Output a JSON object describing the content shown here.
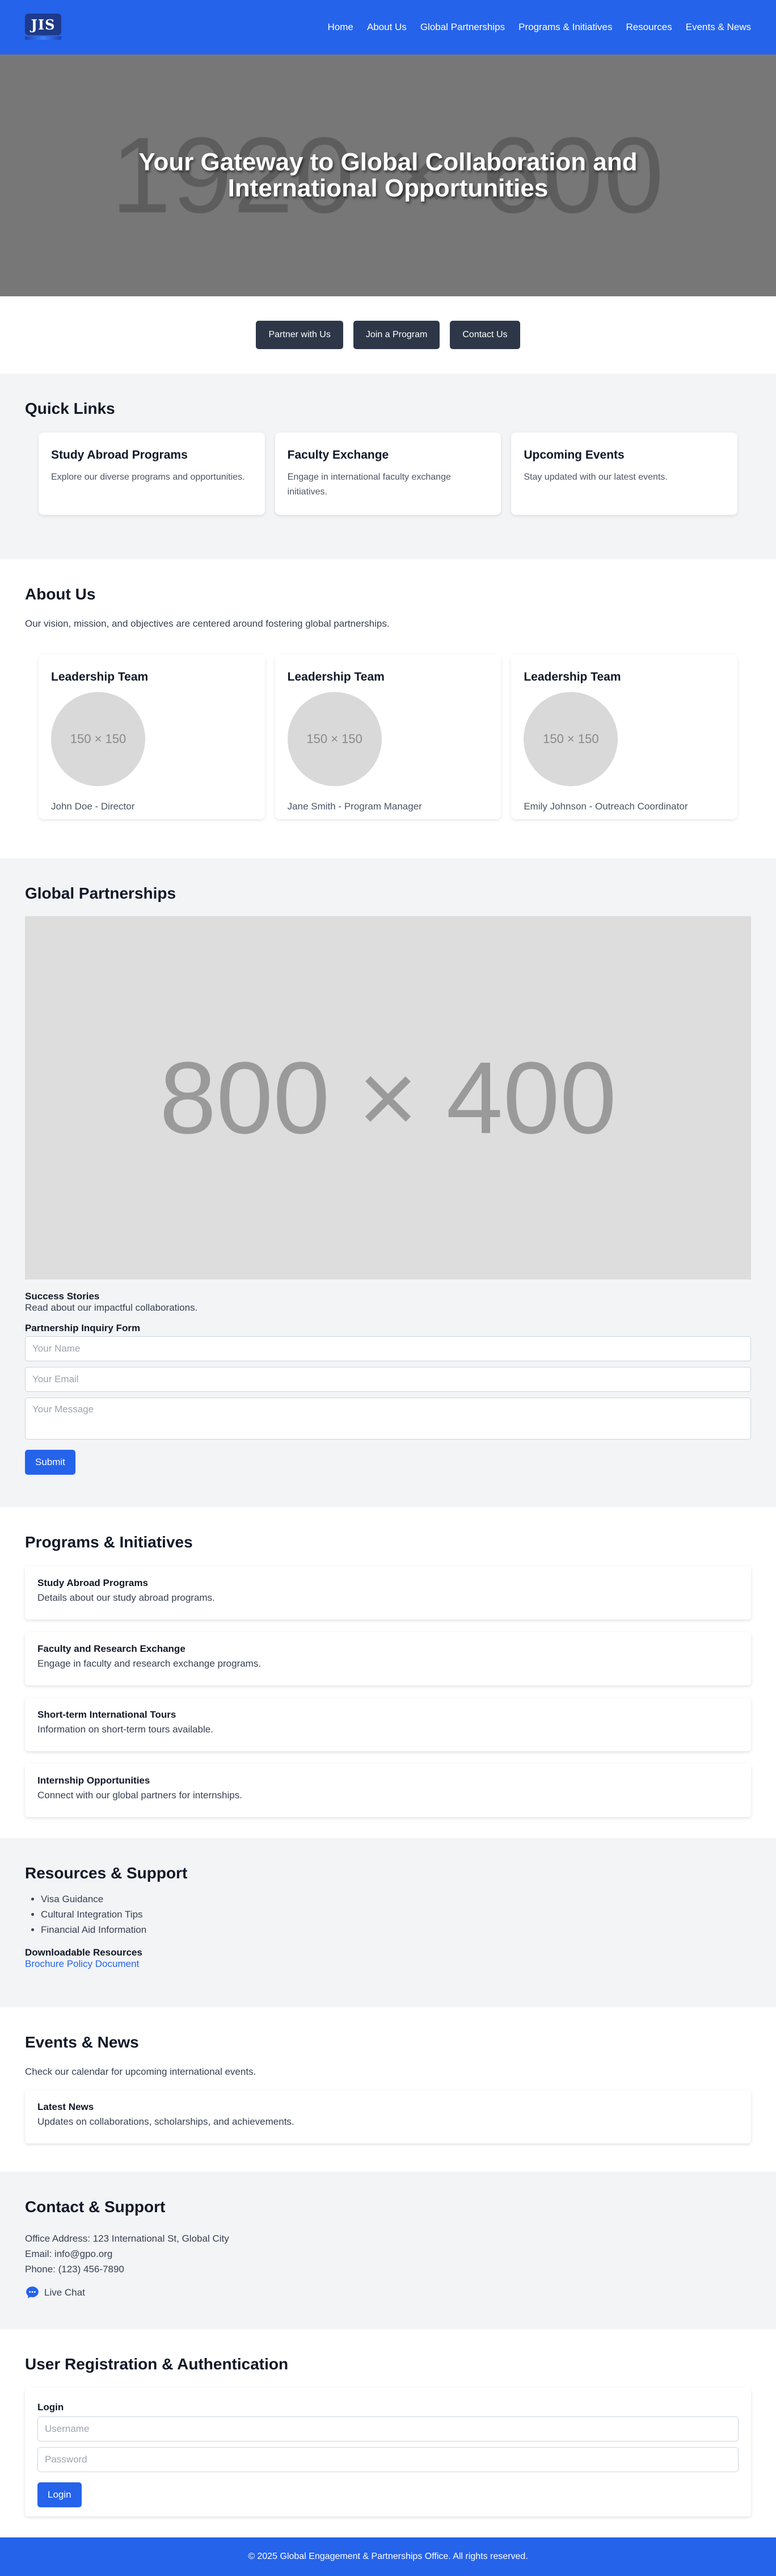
{
  "header": {
    "logo_text": "JIS",
    "nav": [
      "Home",
      "About Us",
      "Global Partnerships",
      "Programs & Initiatives",
      "Resources",
      "Events & News"
    ]
  },
  "hero": {
    "placeholder": "1920 × 600",
    "title": "Your Gateway to Global Collaboration and International Opportunities"
  },
  "cta": [
    "Partner with Us",
    "Join a Program",
    "Contact Us"
  ],
  "quick_links": {
    "title": "Quick Links",
    "cards": [
      {
        "title": "Study Abroad Programs",
        "text": "Explore our diverse programs and opportunities."
      },
      {
        "title": "Faculty Exchange",
        "text": "Engage in international faculty exchange initiatives."
      },
      {
        "title": "Upcoming Events",
        "text": "Stay updated with our latest events."
      }
    ]
  },
  "about": {
    "title": "About Us",
    "desc": "Our vision, mission, and objectives are centered around fostering global partnerships.",
    "team": [
      {
        "heading": "Leadership Team",
        "placeholder": "150 × 150",
        "name": "John Doe - Director"
      },
      {
        "heading": "Leadership Team",
        "placeholder": "150 × 150",
        "name": "Jane Smith - Program Manager"
      },
      {
        "heading": "Leadership Team",
        "placeholder": "150 × 150",
        "name": "Emily Johnson - Outreach Coordinator"
      }
    ]
  },
  "partnerships": {
    "title": "Global Partnerships",
    "map_placeholder": "800 × 400",
    "stories_title": "Success Stories",
    "stories_text": "Read about our impactful collaborations.",
    "form_title": "Partnership Inquiry Form",
    "name_placeholder": "Your Name",
    "email_placeholder": "Your Email",
    "message_placeholder": "Your Message",
    "submit": "Submit"
  },
  "programs": {
    "title": "Programs & Initiatives",
    "items": [
      {
        "title": "Study Abroad Programs",
        "text": "Details about our study abroad programs."
      },
      {
        "title": "Faculty and Research Exchange",
        "text": "Engage in faculty and research exchange programs."
      },
      {
        "title": "Short-term International Tours",
        "text": "Information on short-term tours available."
      },
      {
        "title": "Internship Opportunities",
        "text": "Connect with our global partners for internships."
      }
    ]
  },
  "resources": {
    "title": "Resources & Support",
    "list": [
      "Visa Guidance",
      "Cultural Integration Tips",
      "Financial Aid Information"
    ],
    "downloads_title": "Downloadable Resources",
    "download_link": "Brochure Policy Document"
  },
  "events": {
    "title": "Events & News",
    "desc": "Check our calendar for upcoming international events.",
    "news_title": "Latest News",
    "news_text": "Updates on collaborations, scholarships, and achievements."
  },
  "contact": {
    "title": "Contact & Support",
    "address": "Office Address: 123 International St, Global City",
    "email": "Email: info@gpo.org",
    "phone": "Phone: (123) 456-7890",
    "chat": "Live Chat"
  },
  "auth": {
    "title": "User Registration & Authentication",
    "login_title": "Login",
    "username_placeholder": "Username",
    "password_placeholder": "Password",
    "login_button": "Login"
  },
  "footer": {
    "text": "© 2025 Global Engagement & Partnerships Office. All rights reserved."
  },
  "colors": {
    "primary": "#2563eb",
    "dark_button": "#2d3748",
    "section_gray": "#f3f4f6"
  }
}
